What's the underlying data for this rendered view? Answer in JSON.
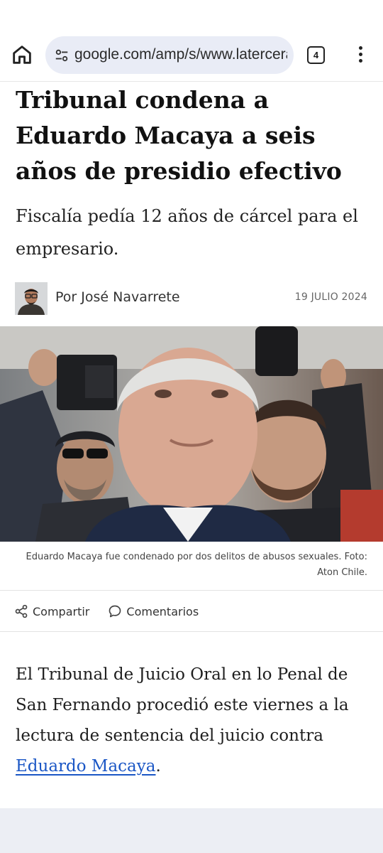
{
  "browser": {
    "url": "google.com/amp/s/www.latercera.com",
    "tab_count": "4"
  },
  "article": {
    "headline": "Tribunal condena a Eduardo Macaya a seis años de presidio efectivo",
    "subheadline": "Fiscalía pedía 12 años de cárcel para el empresario.",
    "author": "Por José Navarrete",
    "date": "19 JULIO 2024",
    "photo_caption": "Eduardo Macaya fue condenado por dos delitos de abusos sexuales. Foto: Aton Chile.",
    "actions": {
      "share_label": "Compartir",
      "comments_label": "Comentarios"
    },
    "body": {
      "text": "El Tribunal de Juicio Oral en lo Penal de San Fernando procedió este viernes a la lectura de sentencia del juicio contra ",
      "link_text": "Eduardo Macaya",
      "tail": "."
    }
  },
  "colors": {
    "url_bar_bg": "#e9ecf6",
    "link": "#1a56c5",
    "footer_band": "#eceef4"
  },
  "icons": [
    "home-icon",
    "site-settings-icon",
    "tab-switcher-icon",
    "more-menu-icon",
    "share-icon",
    "comment-icon"
  ]
}
